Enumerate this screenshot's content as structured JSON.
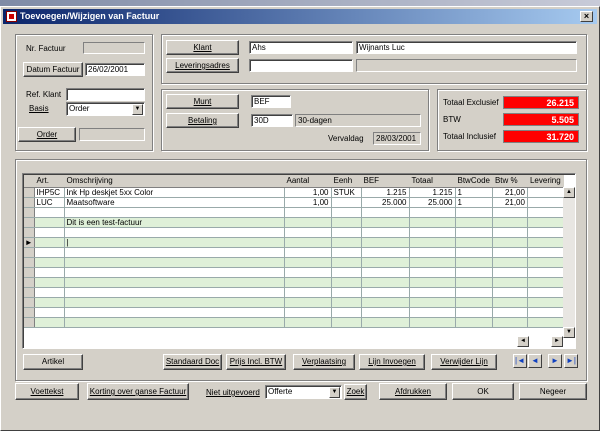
{
  "window": {
    "title": "Toevoegen/Wijzigen van Factuur",
    "close_glyph": "×"
  },
  "invoice": {
    "nr_label": "Nr. Factuur",
    "nr_value": "",
    "date_button": "Datum Factuur",
    "date_value": "26/02/2001",
    "ref_label": "Ref. Klant",
    "ref_value": "",
    "basis_label": "Basis",
    "basis_value": "Order",
    "order_button": "Order",
    "order_value": ""
  },
  "client": {
    "klant_button": "Klant",
    "klant_code": "Ahs",
    "klant_name": "Wijnants Luc",
    "lever_button": "Leveringsadres",
    "lever_value1": "",
    "lever_value2": ""
  },
  "currency": {
    "munt_button": "Munt",
    "munt_value": "BEF",
    "betaling_button": "Betaling",
    "betaling_code": "30D",
    "betaling_desc": "30-dagen",
    "vervaldag_label": "Vervaldag",
    "vervaldag_value": "28/03/2001"
  },
  "totals": {
    "excl_label": "Totaal Exclusief",
    "excl_value": "26.215",
    "btw_label": "BTW",
    "btw_value": "5.505",
    "incl_label": "Totaal Inclusief",
    "incl_value": "31.720",
    "value_color": "#ff0000"
  },
  "grid": {
    "columns": [
      "Art.",
      "Omschrijving",
      "Aantal",
      "Eenh",
      "BEF",
      "Totaal",
      "BtwCode",
      "Btw %",
      "Levering"
    ],
    "rows": [
      [
        "IHP5C",
        "Ink Hp deskjet 5xx Color",
        "1,00",
        "STUK",
        "1.215",
        "1.215",
        "1",
        "21,00",
        ""
      ],
      [
        "LUC",
        "Maatsoftware",
        "1,00",
        "",
        "25.000",
        "25.000",
        "1",
        "21,00",
        ""
      ],
      [
        "",
        "",
        "",
        "",
        "",
        "",
        "",
        "",
        ""
      ],
      [
        "",
        "Dit is een test-factuur",
        "",
        "",
        "",
        "",
        "",
        "",
        ""
      ],
      [
        "",
        "",
        "",
        "",
        "",
        "",
        "",
        "",
        ""
      ],
      [
        "",
        "|",
        "",
        "",
        "",
        "",
        "",
        "",
        ""
      ],
      [
        "",
        "",
        "",
        "",
        "",
        "",
        "",
        "",
        ""
      ],
      [
        "",
        "",
        "",
        "",
        "",
        "",
        "",
        "",
        ""
      ],
      [
        "",
        "",
        "",
        "",
        "",
        "",
        "",
        "",
        ""
      ],
      [
        "",
        "",
        "",
        "",
        "",
        "",
        "",
        "",
        ""
      ],
      [
        "",
        "",
        "",
        "",
        "",
        "",
        "",
        "",
        ""
      ],
      [
        "",
        "",
        "",
        "",
        "",
        "",
        "",
        "",
        ""
      ],
      [
        "",
        "",
        "",
        "",
        "",
        "",
        "",
        "",
        ""
      ],
      [
        "",
        "",
        "",
        "",
        "",
        "",
        "",
        "",
        ""
      ]
    ],
    "current_row_marker": "►",
    "scroll_up": "▲",
    "scroll_down": "▼",
    "scroll_left": "◄",
    "scroll_right": "►"
  },
  "actions": {
    "artikel": "Artikel",
    "standaard": "Standaard Doc",
    "prijs": "Prijs Incl. BTW",
    "verplaatsing": "Verplaatsing",
    "lijn_invoegen": "Lijn Invoegen",
    "verwijder_lijn": "Verwijder Lijn",
    "nav_first": "|◄",
    "nav_prev": "◄",
    "nav_next": "►",
    "nav_last": "►|"
  },
  "footer": {
    "voettekst": "Voettekst",
    "korting": "Korting over ganse Factuur",
    "niet_label": "Niet uitgevoerd",
    "niet_value": "Offerte",
    "zoek": "Zoek",
    "afdrukken": "Afdrukken",
    "ok": "OK",
    "negeer": "Negeer"
  }
}
